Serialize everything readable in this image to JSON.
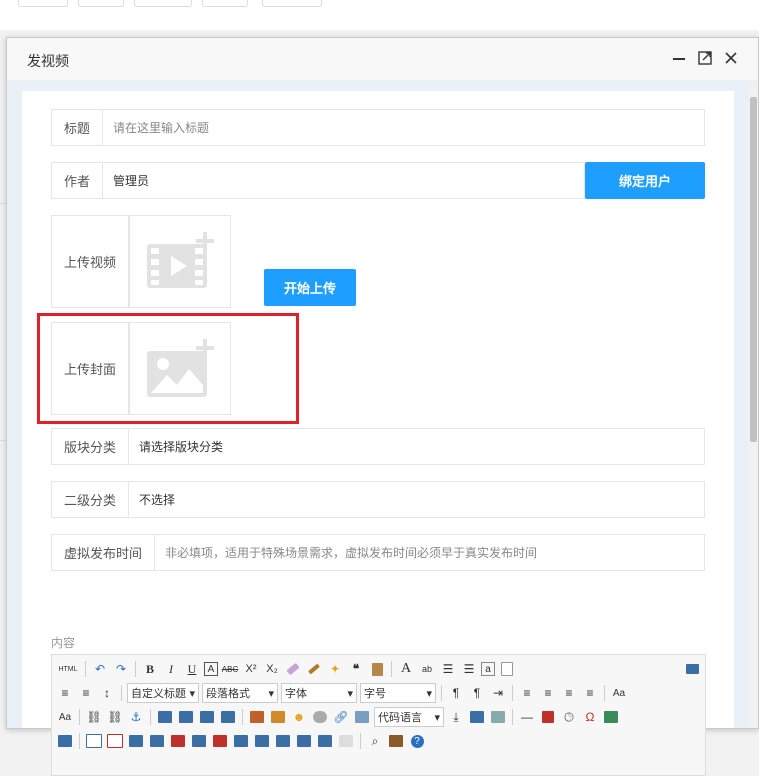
{
  "dialog": {
    "title": "发视频",
    "controls": [
      "minimize-icon",
      "maximize-icon",
      "close-icon"
    ]
  },
  "form": {
    "title_label": "标题",
    "title_placeholder": "请在这里输入标题",
    "author_label": "作者",
    "author_value": "管理员",
    "bind_user_button": "绑定用户",
    "upload_video_label": "上传视频",
    "start_upload_button": "开始上传",
    "upload_cover_label": "上传封面",
    "category_label": "版块分类",
    "category_value": "请选择版块分类",
    "subcategory_label": "二级分类",
    "subcategory_value": "不选择",
    "virtual_time_label": "虚拟发布时间",
    "virtual_time_placeholder": "非必填项，适用于特殊场景需求，虚拟发布时间必须早于真实发布时间",
    "content_label": "内容"
  },
  "editor": {
    "html_label": "HTML",
    "custom_title_select": "自定义标题",
    "paragraph_select": "段落格式",
    "font_select": "字体",
    "size_select": "字号",
    "code_lang_select": "代码语言"
  },
  "colors": {
    "accent": "#1e9fff",
    "highlight": "#e0202a"
  }
}
